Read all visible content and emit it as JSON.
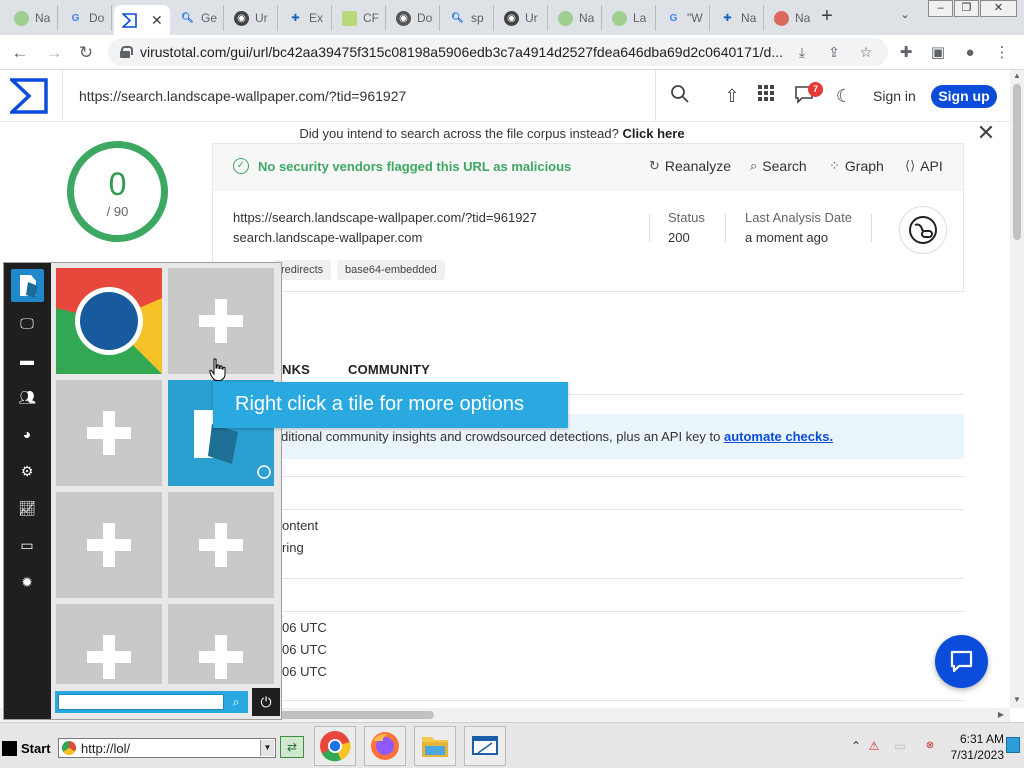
{
  "browser": {
    "tabs": [
      {
        "label": "Na",
        "icon": "landscape-favicon-icon"
      },
      {
        "label": "Do",
        "icon": "google-favicon-icon"
      },
      {
        "label": "",
        "icon": "virustotal-favicon-icon",
        "active": true
      },
      {
        "label": "Ge",
        "icon": "search-favicon-icon"
      },
      {
        "label": "Ur",
        "icon": "globe-favicon-icon"
      },
      {
        "label": "Ex",
        "icon": "puzzle-favicon-icon"
      },
      {
        "label": "CF",
        "icon": "cf-favicon-icon"
      },
      {
        "label": "Do",
        "icon": "globe-favicon-icon"
      },
      {
        "label": "sp",
        "icon": "search-favicon-icon"
      },
      {
        "label": "Ur",
        "icon": "globe-favicon-icon"
      },
      {
        "label": "Na",
        "icon": "landscape-favicon-icon"
      },
      {
        "label": "La",
        "icon": "landscape-favicon-icon"
      },
      {
        "label": "\"W",
        "icon": "google-favicon-icon"
      },
      {
        "label": "Na",
        "icon": "puzzle-favicon-icon"
      },
      {
        "label": "Na",
        "icon": "landscape-favicon-icon"
      }
    ],
    "url": "virustotal.com/gui/url/bc42aa39475f315c08198a5906edb3c7a4914d2527fdea646dba69d2c0640171/d..."
  },
  "vt": {
    "search_value": "https://search.landscape-wallpaper.com/?tid=961927",
    "notification_count": "7",
    "signin_label": "Sign in",
    "signup_label": "Sign up",
    "corpus_note_prefix": "Did you intend to search across the file corpus instead?",
    "corpus_note_link": "Click here",
    "score": "0",
    "score_total": "/ 90",
    "status_message": "No security vendors flagged this URL as malicious",
    "actions": {
      "reanalyze": "Reanalyze",
      "search": "Search",
      "graph": "Graph",
      "api": "API"
    },
    "url_full": "https://search.landscape-wallpaper.com/?tid=961927",
    "url_host": "search.landscape-wallpaper.com",
    "status_label": "Status",
    "status_value": "200",
    "last_analysis_label": "Last Analysis Date",
    "last_analysis_value": "a moment ago",
    "tags": [
      "redirects",
      "base64-embedded"
    ],
    "tabs": [
      "NKS",
      "COMMUNITY"
    ],
    "banner_text": "ditional community insights and crowdsourced detections, plus an API key to",
    "banner_link": "automate checks.",
    "partial_rows": [
      "ontent",
      "ring",
      "06 UTC",
      "06 UTC",
      "06 UTC"
    ]
  },
  "launcher": {
    "tooltip": "Right click a tile for more options",
    "sidebar_icons": [
      "monitor-icon",
      "folder-icon",
      "users-icon",
      "globe-icon",
      "gears-icon",
      "chart-icon",
      "display-icon",
      "settings-icon"
    ]
  },
  "taskbar": {
    "start_label": "Start",
    "address_value": "http://lol/",
    "clock_time": "6:31 AM",
    "clock_date": "7/31/2023"
  },
  "colors": {
    "vt_blue": "#0b4dda",
    "vt_green": "#3da861",
    "launcher_blue": "#2aa8e0"
  }
}
